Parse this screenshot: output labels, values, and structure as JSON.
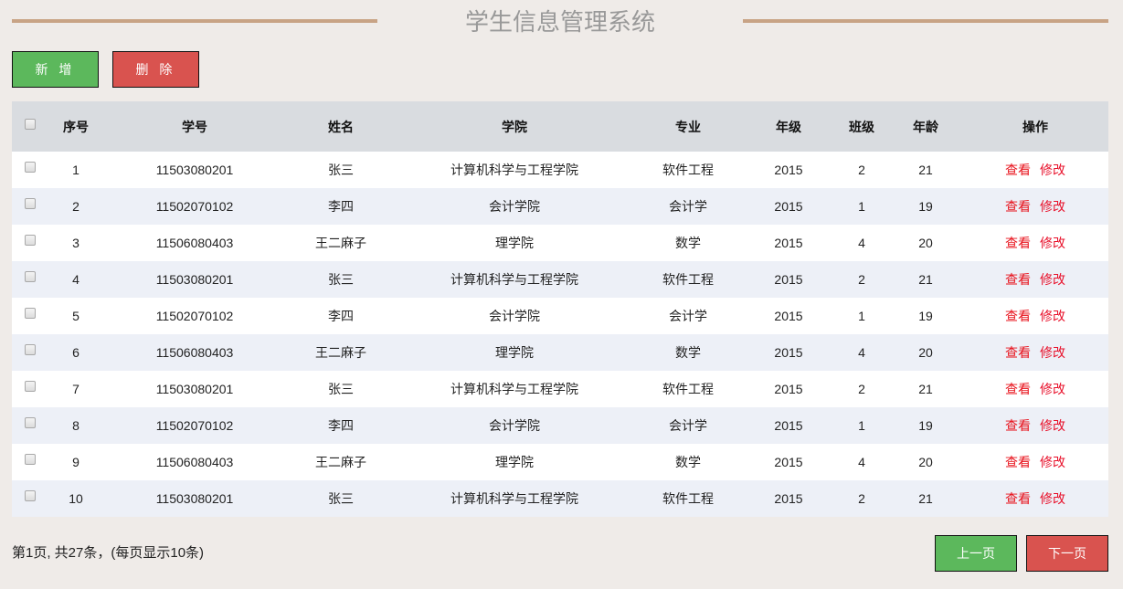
{
  "header": {
    "title": "学生信息管理系统"
  },
  "toolbar": {
    "add_label": "新 增",
    "delete_label": "删 除"
  },
  "colors": {
    "green": "#5cb85c",
    "red": "#d9534f",
    "accent_line": "#c8a385",
    "link_red": "#e8101a"
  },
  "table": {
    "headers": [
      "序号",
      "学号",
      "姓名",
      "学院",
      "专业",
      "年级",
      "班级",
      "年龄",
      "操作"
    ],
    "actions": {
      "view": "查看",
      "edit": "修改"
    },
    "rows": [
      {
        "no": "1",
        "sid": "11503080201",
        "name": "张三",
        "college": "计算机科学与工程学院",
        "major": "软件工程",
        "grade": "2015",
        "class": "2",
        "age": "21"
      },
      {
        "no": "2",
        "sid": "11502070102",
        "name": "李四",
        "college": "会计学院",
        "major": "会计学",
        "grade": "2015",
        "class": "1",
        "age": "19"
      },
      {
        "no": "3",
        "sid": "11506080403",
        "name": "王二麻子",
        "college": "理学院",
        "major": "数学",
        "grade": "2015",
        "class": "4",
        "age": "20"
      },
      {
        "no": "4",
        "sid": "11503080201",
        "name": "张三",
        "college": "计算机科学与工程学院",
        "major": "软件工程",
        "grade": "2015",
        "class": "2",
        "age": "21"
      },
      {
        "no": "5",
        "sid": "11502070102",
        "name": "李四",
        "college": "会计学院",
        "major": "会计学",
        "grade": "2015",
        "class": "1",
        "age": "19"
      },
      {
        "no": "6",
        "sid": "11506080403",
        "name": "王二麻子",
        "college": "理学院",
        "major": "数学",
        "grade": "2015",
        "class": "4",
        "age": "20"
      },
      {
        "no": "7",
        "sid": "11503080201",
        "name": "张三",
        "college": "计算机科学与工程学院",
        "major": "软件工程",
        "grade": "2015",
        "class": "2",
        "age": "21"
      },
      {
        "no": "8",
        "sid": "11502070102",
        "name": "李四",
        "college": "会计学院",
        "major": "会计学",
        "grade": "2015",
        "class": "1",
        "age": "19"
      },
      {
        "no": "9",
        "sid": "11506080403",
        "name": "王二麻子",
        "college": "理学院",
        "major": "数学",
        "grade": "2015",
        "class": "4",
        "age": "20"
      },
      {
        "no": "10",
        "sid": "11503080201",
        "name": "张三",
        "college": "计算机科学与工程学院",
        "major": "软件工程",
        "grade": "2015",
        "class": "2",
        "age": "21"
      }
    ]
  },
  "pagination": {
    "summary": "第1页, 共27条，(每页显示10条)",
    "prev_label": "上一页",
    "next_label": "下一页"
  }
}
